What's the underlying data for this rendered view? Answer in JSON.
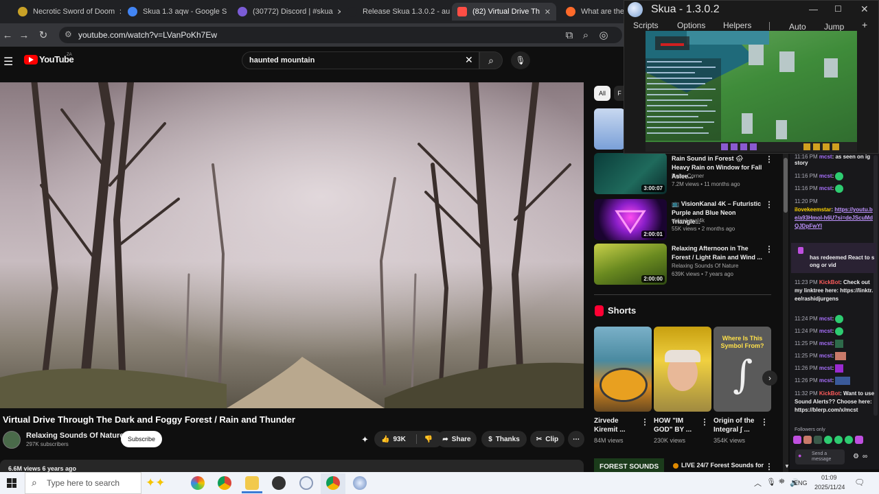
{
  "tabs": [
    {
      "title": "Necrotic Sword of Doom",
      "color": "#c9a227"
    },
    {
      "title": "Skua 1.3 aqw - Google S",
      "color": "#4285f4"
    },
    {
      "title": "(30772) Discord | #skua",
      "color": "#7b5cd6"
    },
    {
      "title": "Release Skua 1.3.0.2 - au",
      "color": "#888888"
    },
    {
      "title": "(82) Virtual Drive Th",
      "color": "#ff4e45"
    },
    {
      "title": "What are the be",
      "color": "#ff6a2a"
    }
  ],
  "address": {
    "url": "youtube.com/watch?v=LVanPoKh7Ew"
  },
  "youtube": {
    "logo": "YouTube",
    "country": "ZA",
    "search_value": "haunted mountain",
    "video_title": "Virtual Drive Through The Dark and Foggy Forest / Rain and Thunder",
    "channel": "Relaxing Sounds Of Nature",
    "subscribers": "297K subscribers",
    "subscribe_label": "Subscribe",
    "likes": "93K",
    "share_label": "Share",
    "thanks_label": "Thanks",
    "clip_label": "Clip",
    "views_line": "6.6M views  6 years ago"
  },
  "chips": {
    "all": "All",
    "next": "F"
  },
  "recommendations": [
    {
      "title": "Rain Sound in Forest 🌧 Heavy Rain on Window for Fall Aslee...",
      "channel": "Relax Corner",
      "meta": "7.2M views • 11 months ago",
      "duration": "3:00:07"
    },
    {
      "title": "📺 VisionKanal 4K – Futuristic Purple and Blue Neon Triangle...",
      "channel": "visionkanal4k",
      "meta": "55K views • 2 months ago",
      "duration": "2:00:01"
    },
    {
      "title": "Relaxing Afternoon in The Forest / Light Rain and Wind ...",
      "channel": "Relaxing Sounds Of Nature",
      "meta": "639K views • 7 years ago",
      "duration": "2:00:00"
    }
  ],
  "shorts": {
    "heading": "Shorts",
    "items": [
      {
        "title": "Zirvede Kiremit ...",
        "views": "84M views"
      },
      {
        "title": "HOW \"IM GOD\" BY ...",
        "views": "230K views"
      },
      {
        "title": "Origin of the Integral ∫ ...",
        "views": "354K views",
        "overlay": "Where Is This Symbol From?"
      }
    ]
  },
  "bottom_rec": {
    "section": "FOREST SOUNDS",
    "live_title": "LIVE 24/7 Forest Sounds for"
  },
  "skua": {
    "title": "Skua - 1.3.0.2",
    "menu": [
      "Scripts",
      "Options",
      "Helpers",
      "Auto",
      "Jump"
    ],
    "plus": "+"
  },
  "chat": {
    "lines": [
      {
        "time": "11:16 PM",
        "user": "mcst",
        "msg": "as seen on ig story"
      },
      {
        "time": "11:16 PM",
        "user": "mcst",
        "msg": ""
      },
      {
        "time": "11:16 PM",
        "user": "mcst",
        "msg": ""
      },
      {
        "time": "11:20 PM",
        "user": "ilovekeemstar",
        "msg": "https://youtu.be/a93Hmol-h6U?si=deJScuMdQJDpFwYl"
      },
      {
        "time": "",
        "user": "",
        "msg": "has redeemed React to s ong or vid"
      },
      {
        "time": "11:23 PM",
        "user": "KickBot",
        "msg": "Check out my linktree here: https://linktr.ee/rashidjurgens"
      },
      {
        "time": "11:24 PM",
        "user": "mcst",
        "msg": ""
      },
      {
        "time": "11:24 PM",
        "user": "mcst",
        "msg": ""
      },
      {
        "time": "11:25 PM",
        "user": "mcst",
        "msg": ""
      },
      {
        "time": "11:25 PM",
        "user": "mcst",
        "msg": ""
      },
      {
        "time": "11:26 PM",
        "user": "mcst",
        "msg": ""
      },
      {
        "time": "11:26 PM",
        "user": "mcst",
        "msg": ""
      },
      {
        "time": "11:32 PM",
        "user": "KickBot",
        "msg": "Want to use Sound Alerts?? Choose here: https://blerp.com/x/mcst"
      }
    ],
    "followers_only": "Followers only",
    "send_placeholder": "Send a message"
  },
  "taskbar": {
    "search_placeholder": "Type here to search",
    "lang": "ENG",
    "time": "01:09",
    "date": "2025/11/24"
  }
}
